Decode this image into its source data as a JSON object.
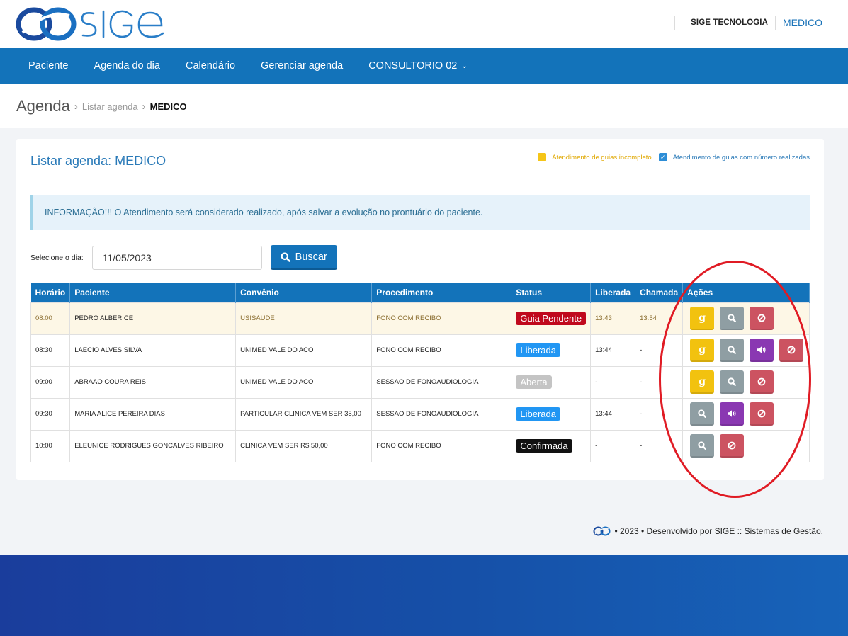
{
  "brand": {
    "name": "SIGE"
  },
  "header": {
    "org": "SIGE TECNOLOGIA",
    "user": "MEDICO"
  },
  "nav": {
    "items": [
      "Paciente",
      "Agenda do dia",
      "Calendário",
      "Gerenciar agenda",
      "CONSULTORIO 02"
    ]
  },
  "breadcrumb": {
    "title": "Agenda",
    "link": "Listar agenda",
    "current": "MEDICO"
  },
  "panel": {
    "title": "Listar agenda: MEDICO",
    "legend_incomplete": "Atendimento de guias incompleto",
    "legend_done": "Atendimento de guias com número realizadas",
    "info": "INFORMAÇÃO!!! O Atendimento será considerado realizado, após salvar a evolução no prontuário do paciente."
  },
  "search": {
    "label": "Selecione o dia:",
    "date": "11/05/2023",
    "button": "Buscar"
  },
  "table": {
    "headers": [
      "Horário",
      "Paciente",
      "Convênio",
      "Procedimento",
      "Status",
      "Liberada",
      "Chamada",
      "Ações"
    ],
    "rows": [
      {
        "time": "08:00",
        "patient": "PEDRO ALBERICE",
        "plan": "USISAUDE",
        "procedure": "FONO COM RECIBO",
        "status": "Guia Pendente",
        "released": "13:43",
        "called": "13:54"
      },
      {
        "time": "08:30",
        "patient": "LAECIO ALVES SILVA",
        "plan": "UNIMED VALE DO ACO",
        "procedure": "FONO COM RECIBO",
        "status": "Liberada",
        "released": "13:44",
        "called": "-"
      },
      {
        "time": "09:00",
        "patient": "ABRAAO COURA REIS",
        "plan": "UNIMED VALE DO ACO",
        "procedure": "SESSAO DE FONOAUDIOLOGIA",
        "status": "Aberta",
        "released": "-",
        "called": "-"
      },
      {
        "time": "09:30",
        "patient": "MARIA ALICE PEREIRA DIAS",
        "plan": "PARTICULAR CLINICA VEM SER 35,00",
        "procedure": "SESSAO DE FONOAUDIOLOGIA",
        "status": "Liberada",
        "released": "13:44",
        "called": "-"
      },
      {
        "time": "10:00",
        "patient": "ELEUNICE RODRIGUES GONCALVES RIBEIRO",
        "plan": "CLINICA VEM SER R$ 50,00",
        "procedure": "FONO COM RECIBO",
        "status": "Confirmada",
        "released": "-",
        "called": "-"
      }
    ],
    "guide_button_glyph": "g"
  },
  "footer": {
    "text": "• 2023 • Desenvolvido por SIGE :: Sistemas de Gestão."
  },
  "colors": {
    "primary": "#1373ba",
    "warning": "#f2c20f",
    "danger": "#cc5361",
    "purple": "#8a38b2",
    "annotation": "#e01b24"
  }
}
